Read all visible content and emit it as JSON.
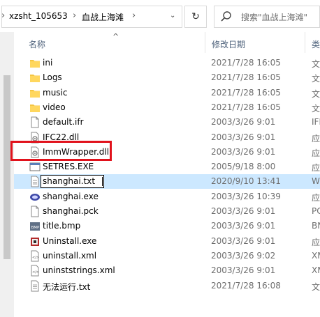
{
  "address": {
    "crumbs": [
      "xzsht_105653",
      "血战上海滩"
    ],
    "separator": "›",
    "dropdown": "⌄",
    "refresh": "↻"
  },
  "search": {
    "placeholder": "搜索\"血战上海滩\""
  },
  "columns": {
    "name": "名称",
    "date": "修改日期",
    "type": "类",
    "sort_arrow": "^"
  },
  "files": [
    {
      "name": "ini",
      "date": "2021/7/28 16:05",
      "type": "文",
      "icon": "folder-icon"
    },
    {
      "name": "Logs",
      "date": "2021/7/28 16:05",
      "type": "文",
      "icon": "folder-icon"
    },
    {
      "name": "music",
      "date": "2021/7/28 16:05",
      "type": "文",
      "icon": "folder-icon"
    },
    {
      "name": "video",
      "date": "2021/7/28 16:05",
      "type": "文",
      "icon": "folder-icon"
    },
    {
      "name": "default.ifr",
      "date": "2003/3/26 9:01",
      "type": "IFI",
      "icon": "file-icon"
    },
    {
      "name": "IFC22.dll",
      "date": "2003/3/26 9:01",
      "type": "应",
      "icon": "dll-icon"
    },
    {
      "name": "ImmWrapper.dll",
      "date": "2003/3/26 9:01",
      "type": "应",
      "icon": "dll-icon"
    },
    {
      "name": "SETRES.EXE",
      "date": "2005/9/18 8:00",
      "type": "应",
      "icon": "exe-icon"
    },
    {
      "name": "shanghai.txt",
      "date": "2020/9/10 13:41",
      "type": "W",
      "icon": "txt-icon"
    },
    {
      "name": "shanghai.exe",
      "date": "2003/3/26 10:39",
      "type": "应",
      "icon": "app-icon"
    },
    {
      "name": "shanghai.pck",
      "date": "2003/3/26 9:01",
      "type": "PC",
      "icon": "file-icon"
    },
    {
      "name": "title.bmp",
      "date": "2003/3/26 9:01",
      "type": "BN",
      "icon": "bmp-icon"
    },
    {
      "name": "Uninstall.exe",
      "date": "2003/3/26 9:01",
      "type": "应",
      "icon": "uninstall-icon"
    },
    {
      "name": "uninstall.xml",
      "date": "2003/3/26 9:02",
      "type": "XM",
      "icon": "xml-icon"
    },
    {
      "name": "uninststrings.xml",
      "date": "2003/3/26 9:01",
      "type": "XM",
      "icon": "xml-icon"
    },
    {
      "name": "无法运行.txt",
      "date": "2021/7/28 16:08",
      "type": "文",
      "icon": "txt-icon"
    }
  ],
  "selected_index": 8,
  "rename_value": "shanghai.txt",
  "colors": {
    "selection": "#cce8ff",
    "highlight_box": "#e1121c",
    "folder": "#f4c542"
  }
}
